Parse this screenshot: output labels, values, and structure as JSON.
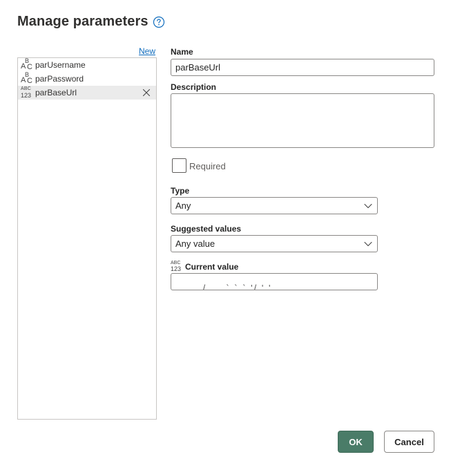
{
  "dialog": {
    "title": "Manage parameters",
    "help_icon": "question-circle-icon"
  },
  "parameters": {
    "new_label": "New",
    "items": [
      {
        "label": "parUsername",
        "type_icon": "text-type-icon",
        "glyph_top": "B",
        "glyph_left": "A",
        "glyph_right": "C"
      },
      {
        "label": "parPassword",
        "type_icon": "text-type-icon",
        "glyph_top": "B",
        "glyph_left": "A",
        "glyph_right": "C"
      },
      {
        "label": "parBaseUrl",
        "type_icon": "any-type-icon",
        "glyph_top": "ABC",
        "glyph_bottom": "123",
        "selected": true
      }
    ]
  },
  "form": {
    "name_label": "Name",
    "name_value": "parBaseUrl",
    "description_label": "Description",
    "description_value": "",
    "required_label": "Required",
    "required_checked": false,
    "type_label": "Type",
    "type_value": "Any",
    "suggested_label": "Suggested values",
    "suggested_value": "Any value",
    "current_label": "Current value",
    "current_glyph_top": "ABC",
    "current_glyph_bottom": "123",
    "current_value_visible": ". . , / . . ` ` ` '/ ' '"
  },
  "footer": {
    "ok_label": "OK",
    "cancel_label": "Cancel"
  },
  "colors": {
    "accent": "#4a7c68",
    "link": "#0f6cbd",
    "selected_row": "#ebebeb"
  }
}
